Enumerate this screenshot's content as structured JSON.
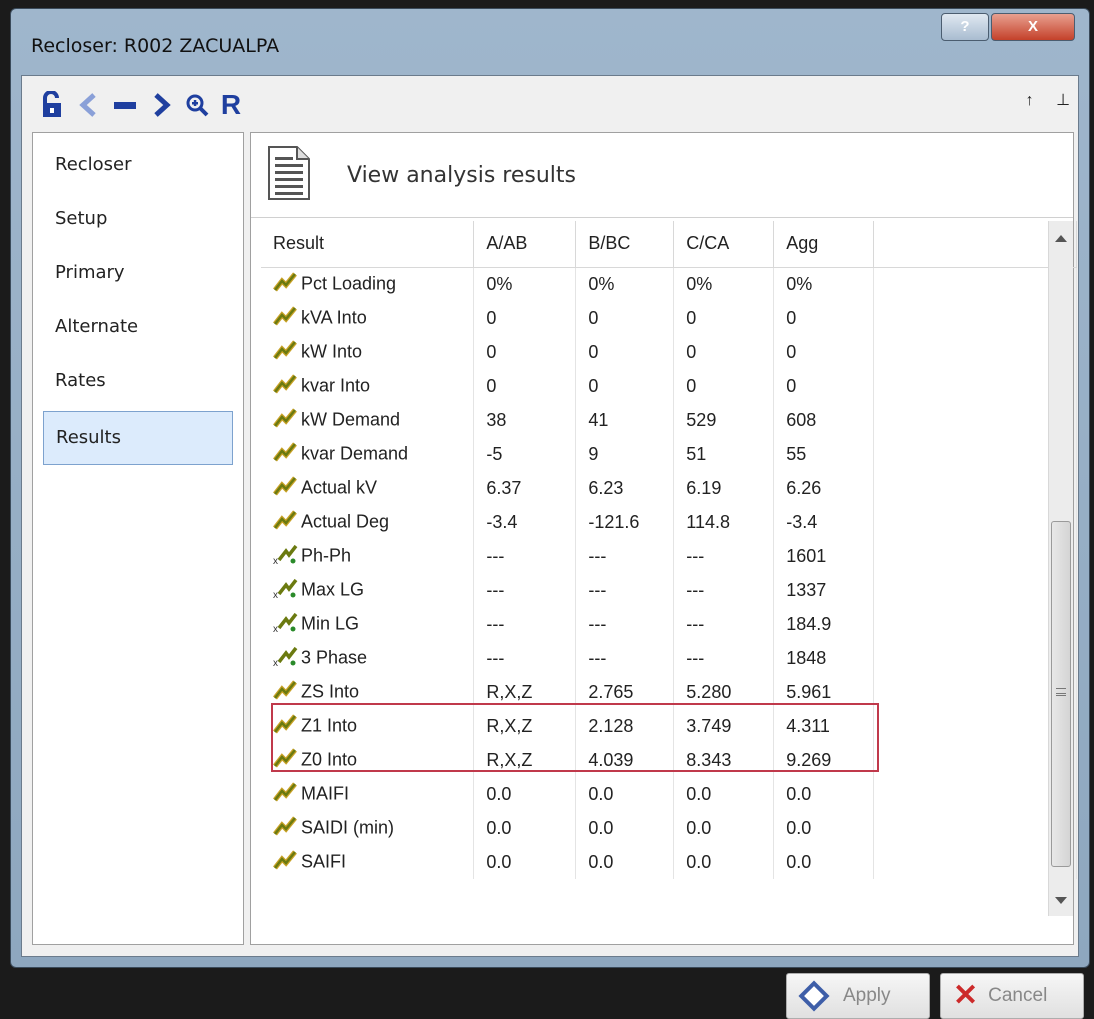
{
  "window": {
    "title": "Recloser: R002 ZACUALPA",
    "help_label": "?",
    "close_label": "X"
  },
  "toolbar": {
    "tools": [
      "lock-icon",
      "prev-icon",
      "minus-icon",
      "next-icon",
      "zoom-icon",
      "r-icon"
    ],
    "r_label": "R",
    "pin_up": "↑",
    "pin": "⊥"
  },
  "nav": {
    "items": [
      {
        "label": "Recloser"
      },
      {
        "label": "Setup"
      },
      {
        "label": "Primary"
      },
      {
        "label": "Alternate"
      },
      {
        "label": "Rates"
      },
      {
        "label": "Results",
        "active": true
      }
    ]
  },
  "header": {
    "title": "View analysis results"
  },
  "grid": {
    "columns": [
      "Result",
      "A/AB",
      "B/BC",
      "C/CA",
      "Agg",
      ""
    ],
    "rows": [
      {
        "icon": "result-icon",
        "cells": [
          "Pct Loading",
          "0%",
          "0%",
          "0%",
          "0%"
        ]
      },
      {
        "icon": "result-icon",
        "cells": [
          "kVA Into",
          "0",
          "0",
          "0",
          "0"
        ]
      },
      {
        "icon": "result-icon",
        "cells": [
          "kW Into",
          "0",
          "0",
          "0",
          "0"
        ]
      },
      {
        "icon": "result-icon",
        "cells": [
          "kvar Into",
          "0",
          "0",
          "0",
          "0"
        ]
      },
      {
        "icon": "result-icon",
        "cells": [
          "kW Demand",
          "38",
          "41",
          "529",
          "608"
        ]
      },
      {
        "icon": "result-icon",
        "cells": [
          "kvar Demand",
          "-5",
          "9",
          "51",
          "55"
        ]
      },
      {
        "icon": "result-icon",
        "cells": [
          "Actual kV",
          "6.37",
          "6.23",
          "6.19",
          "6.26"
        ]
      },
      {
        "icon": "result-icon",
        "cells": [
          "Actual Deg",
          "-3.4",
          "-121.6",
          "114.8",
          "-3.4"
        ]
      },
      {
        "icon": "fault-icon",
        "cells": [
          "Ph-Ph",
          "---",
          "---",
          "---",
          "1601"
        ]
      },
      {
        "icon": "fault-icon",
        "cells": [
          "Max LG",
          "---",
          "---",
          "---",
          "1337"
        ]
      },
      {
        "icon": "fault-icon",
        "cells": [
          "Min LG",
          "---",
          "---",
          "---",
          "184.9"
        ]
      },
      {
        "icon": "fault-icon",
        "cells": [
          "3 Phase",
          "---",
          "---",
          "---",
          "1848"
        ]
      },
      {
        "icon": "result-icon",
        "cells": [
          "ZS Into",
          "R,X,Z",
          "2.765",
          "5.280",
          "5.961"
        ]
      },
      {
        "icon": "result-icon",
        "cells": [
          "Z1 Into",
          "R,X,Z",
          "2.128",
          "3.749",
          "4.311"
        ],
        "highlight": true
      },
      {
        "icon": "result-icon",
        "cells": [
          "Z0 Into",
          "R,X,Z",
          "4.039",
          "8.343",
          "9.269"
        ],
        "highlight": true
      },
      {
        "icon": "result-icon",
        "cells": [
          "MAIFI",
          "0.0",
          "0.0",
          "0.0",
          "0.0"
        ]
      },
      {
        "icon": "result-icon",
        "cells": [
          "SAIDI (min)",
          "0.0",
          "0.0",
          "0.0",
          "0.0"
        ]
      },
      {
        "icon": "result-icon",
        "cells": [
          "SAIFI",
          "0.0",
          "0.0",
          "0.0",
          "0.0"
        ]
      }
    ]
  },
  "buttons": {
    "apply": "Apply",
    "cancel": "Cancel"
  },
  "colors": {
    "highlight_border": "#c0394b",
    "active_nav_bg": "#dcebfc",
    "icon_green": "#6b7a10",
    "icon_gold": "#c9a227",
    "toolbar_blue": "#1f3f9f"
  }
}
